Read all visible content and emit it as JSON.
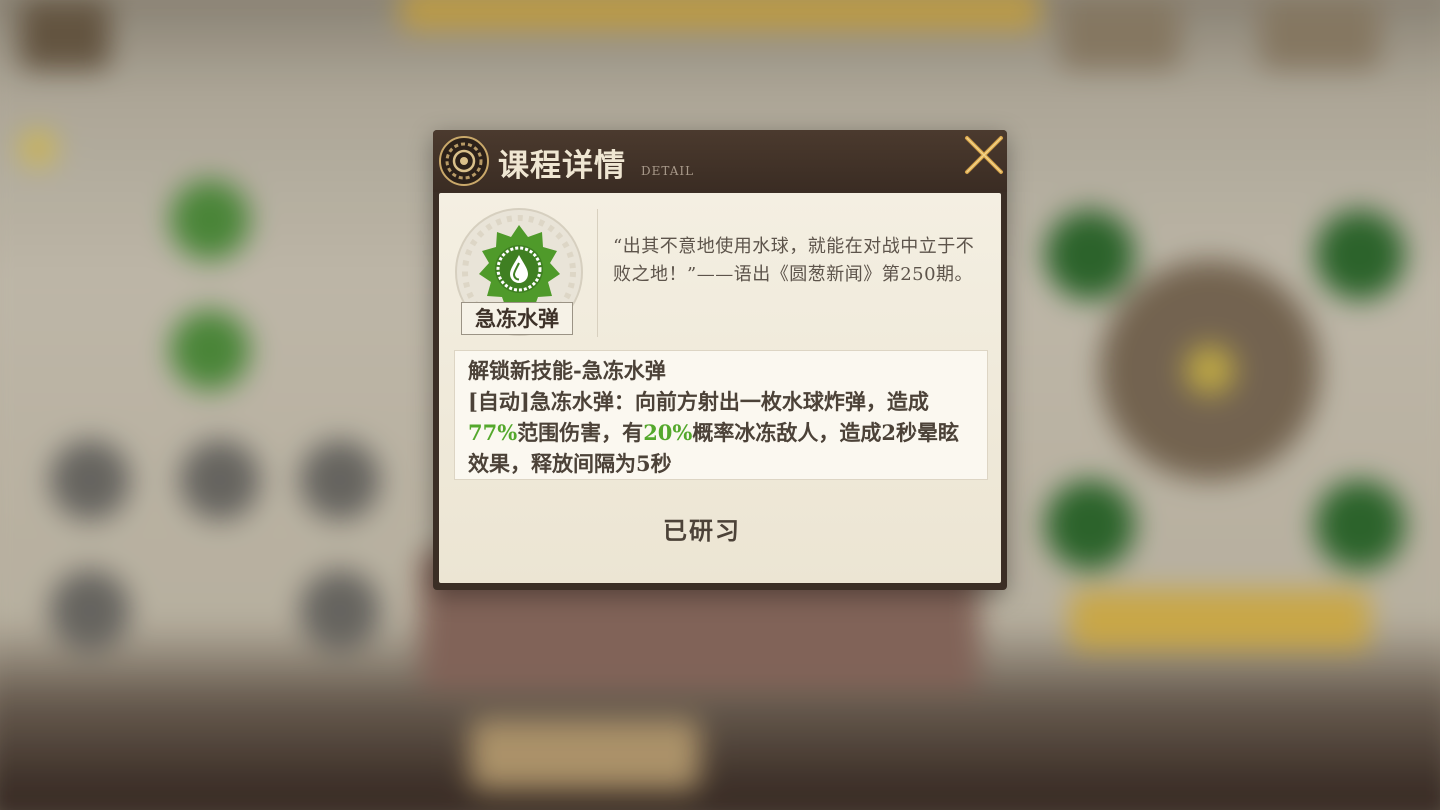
{
  "dialog": {
    "title": "课程详情",
    "subtitle": "DETAIL",
    "close_icon": "close-icon"
  },
  "skill": {
    "name": "急冻水弹",
    "icon": "water-drop-gear-icon",
    "icon_color": "#4f9a2a",
    "quote": "“出其不意地使用水球，就能在对战中立于不败之地！”——语出《圆葱新闻》第250期。"
  },
  "description": {
    "title": "解锁新技能-急冻水弹",
    "line_prefix": "[自动]急冻水弹：向前方射出一枚水球炸弹，造成",
    "damage_percent": "77%",
    "line_middle": "范围伤害，有",
    "freeze_chance": "20%",
    "line_suffix": "概率冰冻敌人，造成2秒晕眩效果，释放间隔为5秒",
    "highlight_color": "#54a82c"
  },
  "status": {
    "label": "已研习"
  }
}
